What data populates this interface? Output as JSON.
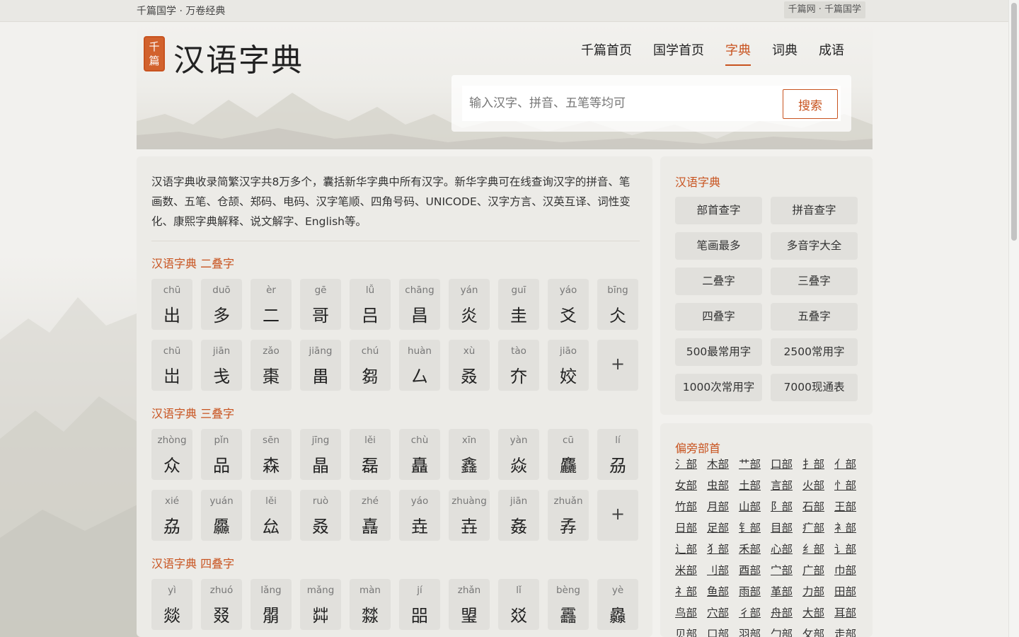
{
  "topbar": {
    "left_text": "千篇国学 · 万卷经典",
    "right_text": "千篇网 · 千篇国学"
  },
  "logo": {
    "seal_text": "千篇",
    "title": "汉语字典"
  },
  "nav": [
    {
      "label": "千篇首页",
      "active": false
    },
    {
      "label": "国学首页",
      "active": false
    },
    {
      "label": "字典",
      "active": true
    },
    {
      "label": "词典",
      "active": false
    },
    {
      "label": "成语",
      "active": false
    }
  ],
  "search": {
    "placeholder": "输入汉字、拼音、五笔等均可",
    "value": "",
    "button": "搜索"
  },
  "intro": "汉语字典收录简繁汉字共8万多个，囊括新华字典中所有汉字。新华字典可在线查询汉字的拼音、笔画数、五笔、仓颉、郑码、电码、汉字笔顺、四角号码、UNICODE、汉字方言、汉英互译、词性变化、康熙字典解释、说文解字、English等。",
  "sections": [
    {
      "title": "汉语字典 二叠字",
      "chars": [
        {
          "py": "chū",
          "ch": "出"
        },
        {
          "py": "duō",
          "ch": "多"
        },
        {
          "py": "èr",
          "ch": "二"
        },
        {
          "py": "gē",
          "ch": "哥"
        },
        {
          "py": "lǚ",
          "ch": "吕"
        },
        {
          "py": "chāng",
          "ch": "昌"
        },
        {
          "py": "yán",
          "ch": "炎"
        },
        {
          "py": "guī",
          "ch": "圭"
        },
        {
          "py": "yáo",
          "ch": "爻"
        },
        {
          "py": "bīng",
          "ch": "仌"
        },
        {
          "py": "chū",
          "ch": "岀"
        },
        {
          "py": "jiān",
          "ch": "戋"
        },
        {
          "py": "zǎo",
          "ch": "棗"
        },
        {
          "py": "jiāng",
          "ch": "畕"
        },
        {
          "py": "chú",
          "ch": "芻"
        },
        {
          "py": "huàn",
          "ch": "厶"
        },
        {
          "py": "xù",
          "ch": "叒"
        },
        {
          "py": "tào",
          "ch": "夰"
        },
        {
          "py": "jiāo",
          "ch": "姣"
        }
      ]
    },
    {
      "title": "汉语字典 三叠字",
      "chars": [
        {
          "py": "zhòng",
          "ch": "众"
        },
        {
          "py": "pǐn",
          "ch": "品"
        },
        {
          "py": "sēn",
          "ch": "森"
        },
        {
          "py": "jīng",
          "ch": "晶"
        },
        {
          "py": "lěi",
          "ch": "磊"
        },
        {
          "py": "chù",
          "ch": "矗"
        },
        {
          "py": "xīn",
          "ch": "鑫"
        },
        {
          "py": "yàn",
          "ch": "焱"
        },
        {
          "py": "cū",
          "ch": "麤"
        },
        {
          "py": "lí",
          "ch": "刕"
        },
        {
          "py": "xié",
          "ch": "劦"
        },
        {
          "py": "yuán",
          "ch": "厵"
        },
        {
          "py": "lěi",
          "ch": "厽"
        },
        {
          "py": "ruò",
          "ch": "叒"
        },
        {
          "py": "zhé",
          "ch": "嚞"
        },
        {
          "py": "yáo",
          "ch": "垚"
        },
        {
          "py": "zhuàng",
          "ch": "壵"
        },
        {
          "py": "jiān",
          "ch": "姦"
        },
        {
          "py": "zhuǎn",
          "ch": "孨"
        }
      ]
    },
    {
      "title": "汉语字典 四叠字",
      "chars": [
        {
          "py": "yì",
          "ch": "燚"
        },
        {
          "py": "zhuó",
          "ch": "叕"
        },
        {
          "py": "lǎng",
          "ch": "朤"
        },
        {
          "py": "mǎng",
          "ch": "茻"
        },
        {
          "py": "màn",
          "ch": "㵘"
        },
        {
          "py": "jí",
          "ch": "㗊"
        },
        {
          "py": "zhǎn",
          "ch": "琞"
        },
        {
          "py": "lǐ",
          "ch": "㸚"
        },
        {
          "py": "bèng",
          "ch": "靐"
        },
        {
          "py": "yè",
          "ch": "灥"
        }
      ]
    }
  ],
  "more_label": "+",
  "side_dict": {
    "title": "汉语字典",
    "buttons": [
      "部首查字",
      "拼音查字",
      "笔画最多",
      "多音字大全",
      "二叠字",
      "三叠字",
      "四叠字",
      "五叠字",
      "500最常用字",
      "2500常用字",
      "1000次常用字",
      "7000现通表"
    ]
  },
  "side_radicals": {
    "title": "偏旁部首",
    "items": [
      "氵部",
      "木部",
      "艹部",
      "口部",
      "扌部",
      "亻部",
      "女部",
      "虫部",
      "土部",
      "言部",
      "火部",
      "忄部",
      "竹部",
      "月部",
      "山部",
      "阝部",
      "石部",
      "王部",
      "日部",
      "足部",
      "钅部",
      "目部",
      "疒部",
      "衤部",
      "辶部",
      "犭部",
      "禾部",
      "心部",
      "纟部",
      "讠部",
      "米部",
      "刂部",
      "酉部",
      "宀部",
      "广部",
      "巾部",
      "礻部",
      "鱼部",
      "雨部",
      "革部",
      "力部",
      "田部",
      "鸟部",
      "穴部",
      "彳部",
      "舟部",
      "大部",
      "耳部",
      "贝部",
      "口部",
      "羽部",
      "勹部",
      "攵部",
      "走部"
    ]
  }
}
